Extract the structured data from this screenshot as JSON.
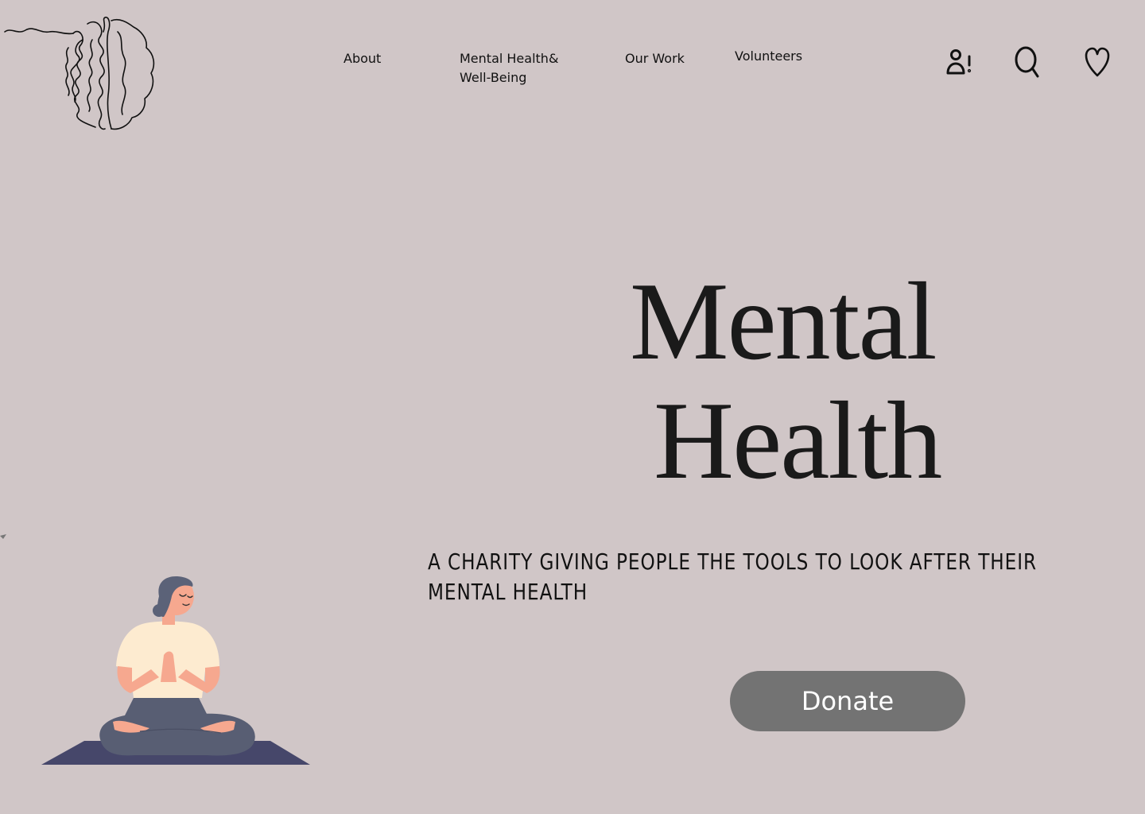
{
  "nav": {
    "about": "About",
    "mental_health_line1": "Mental Health&",
    "mental_health_line2": "Well-Being",
    "our_work": "Our Work",
    "volunteers": "Volunteers"
  },
  "icons": {
    "account": "user-alert-icon",
    "search": "search-icon",
    "favorites": "heart-icon",
    "logo": "brain-logo"
  },
  "hero": {
    "title_line1": "Mental",
    "title_line2": "Health",
    "subtitle": "A CHARITY GIVING PEOPLE THE TOOLS TO LOOK AFTER THEIR MENTAL HEALTH",
    "donate_label": "Donate"
  },
  "colors": {
    "background": "#d0c6c7",
    "donate_button": "#737373",
    "yoga_mat": "#46476a",
    "shirt": "#fdebd0",
    "pants": "#585e73",
    "skin": "#f6a88f",
    "hair": "#5b6278"
  }
}
